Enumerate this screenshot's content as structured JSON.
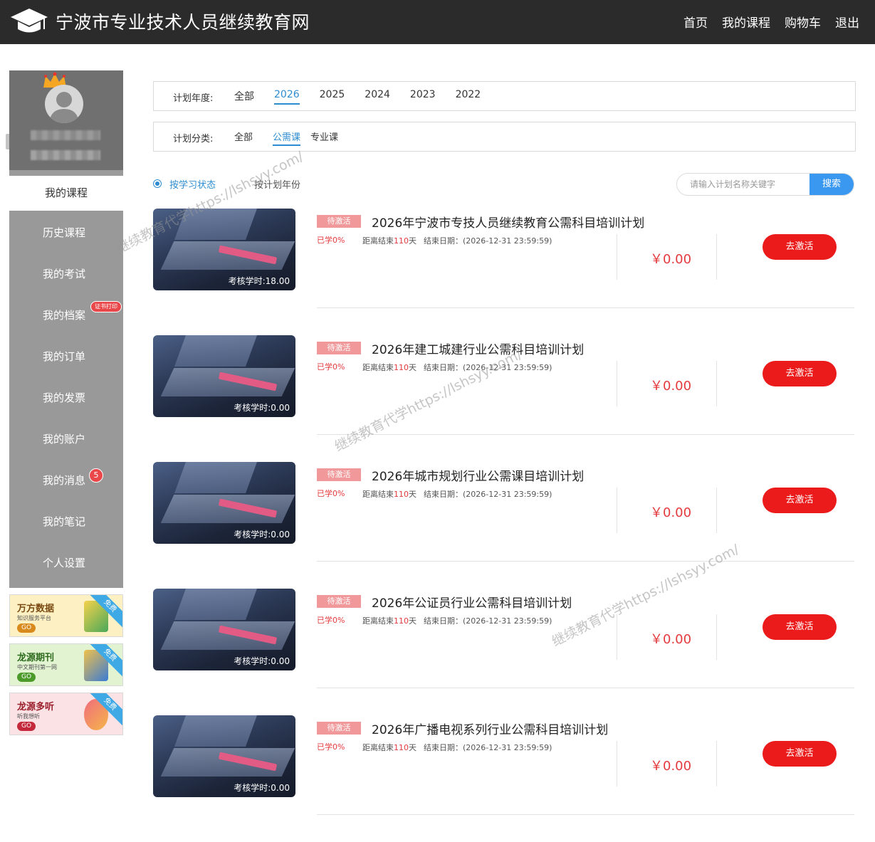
{
  "header": {
    "site_title": "宁波市专业技术人员继续教育网",
    "nav": [
      "首页",
      "我的课程",
      "购物车",
      "退出"
    ]
  },
  "sidebar": {
    "active_label": "我的课程",
    "items": [
      {
        "label": "历史课程"
      },
      {
        "label": "我的考试"
      },
      {
        "label": "我的档案",
        "tag": "证书打印"
      },
      {
        "label": "我的订单"
      },
      {
        "label": "我的发票"
      },
      {
        "label": "我的账户"
      },
      {
        "label": "我的消息",
        "badge": "5"
      },
      {
        "label": "我的笔记"
      },
      {
        "label": "个人设置"
      }
    ],
    "promos": [
      {
        "title": "万方数据",
        "sub": "知识服务平台",
        "go": "GO",
        "ribbon": "免费",
        "color": "#f5d24a",
        "title_color": "#7a4a12"
      },
      {
        "title": "龙源期刊",
        "sub": "中文期刊第一网",
        "go": "GO",
        "ribbon": "免费",
        "color": "#bfe39a",
        "title_color": "#2e6b1e"
      },
      {
        "title": "龙源多听",
        "sub": "听我想听",
        "go": "GO",
        "ribbon": "免费",
        "color": "#f6c9cf",
        "title_color": "#9a1e2b"
      }
    ]
  },
  "filters": {
    "year": {
      "label": "计划年度:",
      "options": [
        "全部",
        "2026",
        "2025",
        "2024",
        "2023",
        "2022"
      ],
      "selected": "2026"
    },
    "category": {
      "label": "计划分类:",
      "options": [
        "全部",
        "公需课",
        "专业课"
      ],
      "selected": "公需课"
    }
  },
  "sort": {
    "by_status": "按学习状态",
    "by_year": "按计划年份"
  },
  "search": {
    "placeholder": "请输入计划名称关键字",
    "button": "搜索"
  },
  "plans": [
    {
      "status": "待激活",
      "title": "2026年宁波市专技人员继续教育公需科目培训计划",
      "progress": "已学0%",
      "days_prefix": "距离结束",
      "days": "110",
      "days_suffix": "天",
      "end_date": "结束日期：(2026-12-31 23:59:59)",
      "hours": "考核学时:18.00",
      "price": "￥0.00",
      "action": "去激活"
    },
    {
      "status": "待激活",
      "title": "2026年建工城建行业公需科目培训计划",
      "progress": "已学0%",
      "days_prefix": "距离结束",
      "days": "110",
      "days_suffix": "天",
      "end_date": "结束日期：(2026-12-31 23:59:59)",
      "hours": "考核学时:0.00",
      "price": "￥0.00",
      "action": "去激活"
    },
    {
      "status": "待激活",
      "title": "2026年城市规划行业公需课目培训计划",
      "progress": "已学0%",
      "days_prefix": "距离结束",
      "days": "110",
      "days_suffix": "天",
      "end_date": "结束日期：(2026-12-31 23:59:59)",
      "hours": "考核学时:0.00",
      "price": "￥0.00",
      "action": "去激活"
    },
    {
      "status": "待激活",
      "title": "2026年公证员行业公需科目培训计划",
      "progress": "已学0%",
      "days_prefix": "距离结束",
      "days": "110",
      "days_suffix": "天",
      "end_date": "结束日期：(2026-12-31 23:59:59)",
      "hours": "考核学时:0.00",
      "price": "￥0.00",
      "action": "去激活"
    },
    {
      "status": "待激活",
      "title": "2026年广播电视系列行业公需科目培训计划",
      "progress": "已学0%",
      "days_prefix": "距离结束",
      "days": "110",
      "days_suffix": "天",
      "end_date": "结束日期：(2026-12-31 23:59:59)",
      "hours": "考核学时:0.00",
      "price": "￥0.00",
      "action": "去激活"
    }
  ],
  "watermark": "继续教育代学https://lshsyy.com/",
  "icons": {
    "logo": "graduation-cap-icon",
    "crown": "crown-icon",
    "avatar": "user-avatar-icon"
  }
}
